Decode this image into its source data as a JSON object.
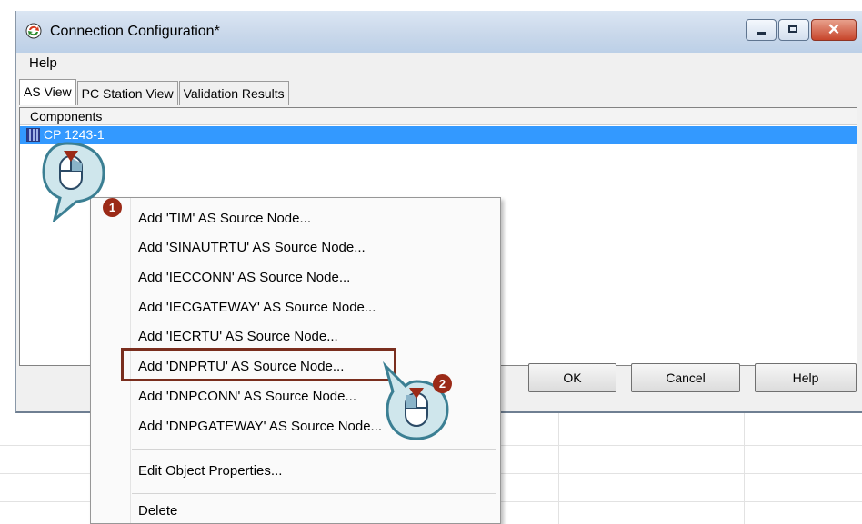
{
  "window": {
    "title": "Connection Configuration*",
    "icon": "refresh-arrows-icon"
  },
  "menubar": {
    "help": "Help"
  },
  "tabs": [
    {
      "label": "AS View",
      "active": true
    },
    {
      "label": "PC Station View",
      "active": false
    },
    {
      "label": "Validation Results",
      "active": false
    }
  ],
  "tree": {
    "column_header": "Components",
    "selected_item": "CP 1243-1"
  },
  "buttons": {
    "ok": "OK",
    "cancel": "Cancel",
    "help": "Help"
  },
  "context_menu": {
    "items": [
      "Add 'TIM' AS Source Node...",
      "Add 'SINAUTRTU' AS Source Node...",
      "Add 'IECCONN' AS Source Node...",
      "Add 'IECGATEWAY' AS Source Node...",
      "Add 'IECRTU' AS Source Node...",
      "Add 'DNPRTU' AS Source Node...",
      "Add 'DNPCONN' AS Source Node...",
      "Add 'DNPGATEWAY' AS Source Node..."
    ],
    "edit_properties": "Edit Object Properties...",
    "delete": "Delete",
    "highlighted_item": "Add 'DNPRTU' AS Source Node..."
  },
  "callouts": [
    {
      "number": "1",
      "icon": "mouse-right-click-icon"
    },
    {
      "number": "2",
      "icon": "mouse-left-click-icon"
    }
  ],
  "colors": {
    "selection": "#3399ff",
    "highlight_border": "#7a2e1e",
    "badge": "#9b2a17",
    "callout_fill": "#cfe6ec"
  }
}
